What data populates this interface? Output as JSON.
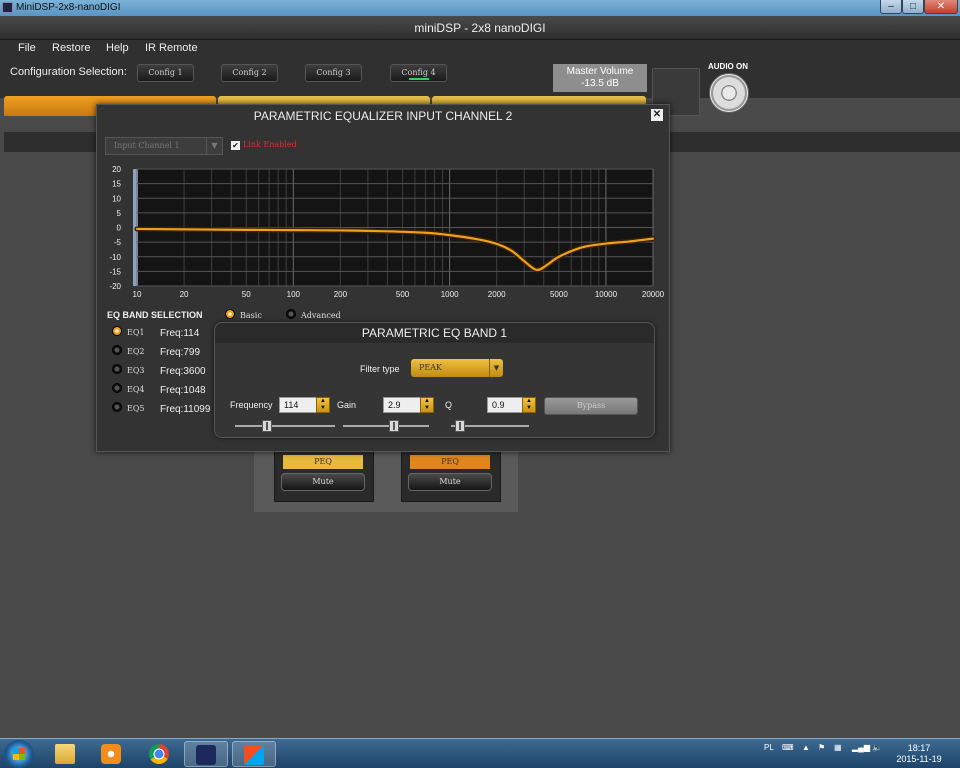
{
  "window": {
    "title": "MiniDSP-2x8-nanoDIGI",
    "min_label": "–",
    "max_label": "□",
    "close_label": "✕"
  },
  "app": {
    "title": "miniDSP - 2x8 nanoDIGI"
  },
  "menu": [
    "File",
    "Restore",
    "Help",
    "IR Remote"
  ],
  "config": {
    "label": "Configuration Selection:",
    "buttons": [
      "Config 1",
      "Config 2",
      "Config 3",
      "Config 4"
    ],
    "active_index": 3
  },
  "master_volume": {
    "label": "Master Volume",
    "value": "-13.5 dB"
  },
  "audio": {
    "label": "AUDIO ON"
  },
  "channels": [
    {
      "peq_label": "PEQ",
      "mute_label": "Mute",
      "peq_color": "#e8b93a"
    },
    {
      "peq_label": "PEQ",
      "mute_label": "Mute",
      "peq_color": "#e0861c"
    }
  ],
  "peq_dialog": {
    "title": "PARAMETRIC EQUALIZER INPUT CHANNEL 2",
    "close_label": "✕",
    "channel_select": "Input Channel 1",
    "link_checked": true,
    "link_label": "Link Enabled",
    "band_selection_label": "EQ BAND SELECTION",
    "mode_options": [
      "Basic",
      "Advanced"
    ],
    "mode_selected": "Basic",
    "bands": [
      {
        "name": "EQ1",
        "freq": "Freq:114"
      },
      {
        "name": "EQ2",
        "freq": "Freq:799"
      },
      {
        "name": "EQ3",
        "freq": "Freq:3600"
      },
      {
        "name": "EQ4",
        "freq": "Freq:1048"
      },
      {
        "name": "EQ5",
        "freq": "Freq:11099"
      }
    ],
    "selected_band": 0
  },
  "chart_data": {
    "type": "line",
    "xscale": "log",
    "xlim": [
      10,
      20000
    ],
    "ylim": [
      -20,
      20
    ],
    "grid": true,
    "x_ticks": [
      "10",
      "20",
      "50",
      "100",
      "200",
      "500",
      "1000",
      "2000",
      "5000",
      "10000",
      "20000"
    ],
    "y_ticks": [
      "20",
      "15",
      "10",
      "5",
      "0",
      "-5",
      "-10",
      "-15",
      "-20"
    ],
    "color": "#f0a020",
    "series": [
      {
        "x": [
          10,
          50,
          100,
          200,
          400,
          700,
          1000,
          1500,
          2000,
          2500,
          3000,
          3600,
          4200,
          5000,
          7000,
          10000,
          14000,
          20000
        ],
        "y": [
          -0.5,
          -0.8,
          -0.9,
          -1.0,
          -1.3,
          -1.8,
          -2.6,
          -4.0,
          -5.6,
          -8.0,
          -11.5,
          -14.5,
          -12.8,
          -10.0,
          -6.8,
          -5.5,
          -4.8,
          -3.8
        ]
      }
    ]
  },
  "band_dialog": {
    "title": "PARAMETRIC EQ BAND 1",
    "filter_type_label": "Filter type",
    "filter_type": "PEAK",
    "frequency_label": "Frequency",
    "frequency": "114",
    "gain_label": "Gain",
    "gain": "2.9",
    "q_label": "Q",
    "q": "0.9",
    "bypass_label": "Bypass"
  },
  "taskbar": {
    "lang": "PL",
    "time": "18:17",
    "date": "2015-11-19"
  }
}
